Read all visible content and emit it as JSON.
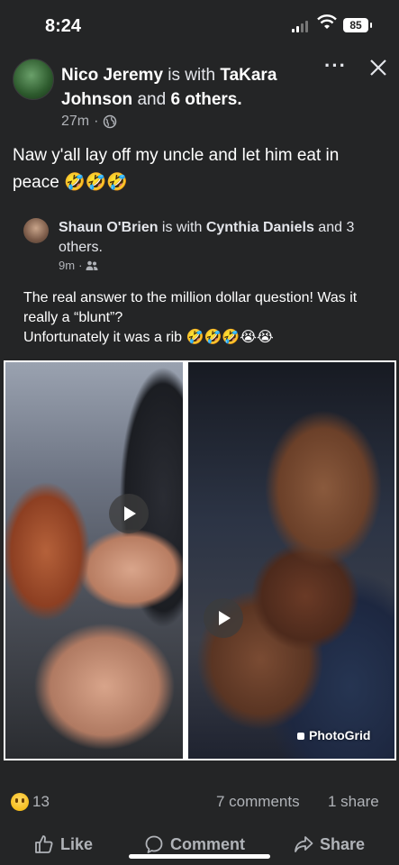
{
  "status_bar": {
    "time": "8:24",
    "battery": "85"
  },
  "post": {
    "author": "Nico Jeremy",
    "with_text": " is with ",
    "tagged": "TaKara Johnson",
    "and_text": " and ",
    "others": "6 others.",
    "time": "27m",
    "text": "Naw y'all lay off my uncle and let him eat in peace 🤣🤣🤣"
  },
  "shared_post": {
    "author": "Shaun O'Brien",
    "with_text": " is with ",
    "tagged": "Cynthia Daniels",
    "and_text": " and 3 others.",
    "time": "9m",
    "line1": "The real answer to the million dollar question! Was it really a “blunt”?",
    "line2": "Unfortunately it was a rib 🤣🤣🤣😭😭"
  },
  "photo_watermark": "PhotoGrid",
  "engagement": {
    "reactions": "13",
    "comments": "7 comments",
    "shares": "1 share"
  },
  "actions": {
    "like": "Like",
    "comment": "Comment",
    "share": "Share"
  },
  "icons": {
    "globe": "globe-icon",
    "friends": "friends-icon",
    "close": "close-icon",
    "more": "more-icon",
    "like": "thumbs-up-icon",
    "comment": "comment-icon",
    "share": "share-icon"
  }
}
